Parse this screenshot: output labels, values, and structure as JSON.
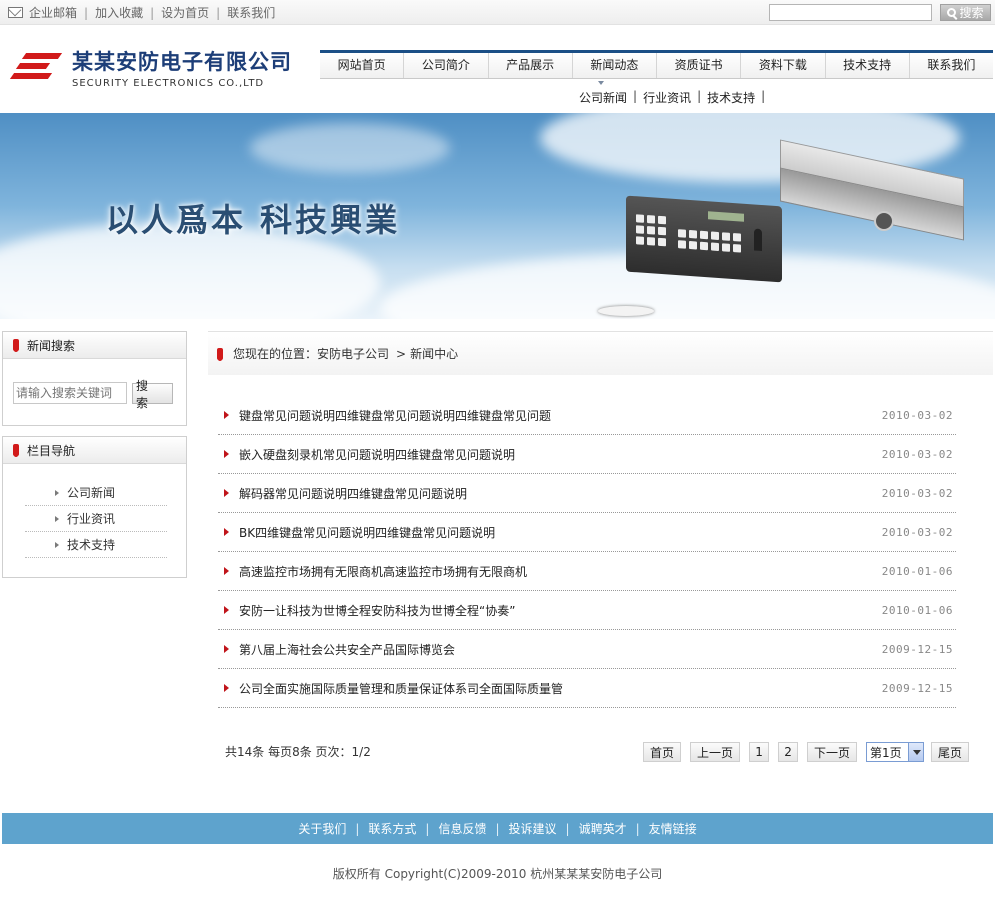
{
  "topbar": {
    "links": [
      "企业邮箱",
      "加入收藏",
      "设为首页",
      "联系我们"
    ],
    "search_button": "搜索"
  },
  "logo": {
    "cn": "某某安防电子有限公司",
    "en": "SECURITY ELECTRONICS CO.,LTD"
  },
  "nav": {
    "items": [
      "网站首页",
      "公司简介",
      "产品展示",
      "新闻动态",
      "资质证书",
      "资料下载",
      "技术支持",
      "联系我们"
    ],
    "sub": [
      "公司新闻",
      "行业资讯",
      "技术支持"
    ]
  },
  "banner": {
    "slogan": "以人爲本 科技興業"
  },
  "sidebar": {
    "search": {
      "title": "新闻搜索",
      "placeholder": "请输入搜索关键词",
      "button": "搜 索"
    },
    "categories": {
      "title": "栏目导航",
      "items": [
        "公司新闻",
        "行业资讯",
        "技术支持"
      ]
    }
  },
  "location": {
    "label": "您现在的位置：安防电子公司",
    "current": "新闻中心"
  },
  "news": [
    {
      "title": "键盘常见问题说明四维键盘常见问题说明四维键盘常见问题",
      "date": "2010-03-02"
    },
    {
      "title": "嵌入硬盘刻录机常见问题说明四维键盘常见问题说明",
      "date": "2010-03-02"
    },
    {
      "title": "解码器常见问题说明四维键盘常见问题说明",
      "date": "2010-03-02"
    },
    {
      "title": "BK四维键盘常见问题说明四维键盘常见问题说明",
      "date": "2010-03-02"
    },
    {
      "title": "高速监控市场拥有无限商机高速监控市场拥有无限商机",
      "date": "2010-01-06"
    },
    {
      "title": "安防一让科技为世博全程安防科技为世博全程“协奏”",
      "date": "2010-01-06"
    },
    {
      "title": "第八届上海社会公共安全产品国际博览会",
      "date": "2009-12-15"
    },
    {
      "title": "公司全面实施国际质量管理和质量保证体系司全面国际质量管",
      "date": "2009-12-15"
    }
  ],
  "pager": {
    "info": "共14条  每页8条  页次：1/2",
    "first": "首页",
    "prev": "上一页",
    "pages": [
      "1",
      "2"
    ],
    "next": "下一页",
    "select_value": "第1页",
    "last": "尾页"
  },
  "footer": {
    "links": [
      "关于我们",
      "联系方式",
      "信息反馈",
      "投诉建议",
      "诚聘英才",
      "友情链接"
    ],
    "copyright": "版权所有  Copyright(C)2009-2010 杭州某某某安防电子公司"
  },
  "colors": {
    "accent_red": "#d11a1a",
    "nav_blue": "#1b4f86",
    "footer_blue": "#5ea3cd"
  }
}
